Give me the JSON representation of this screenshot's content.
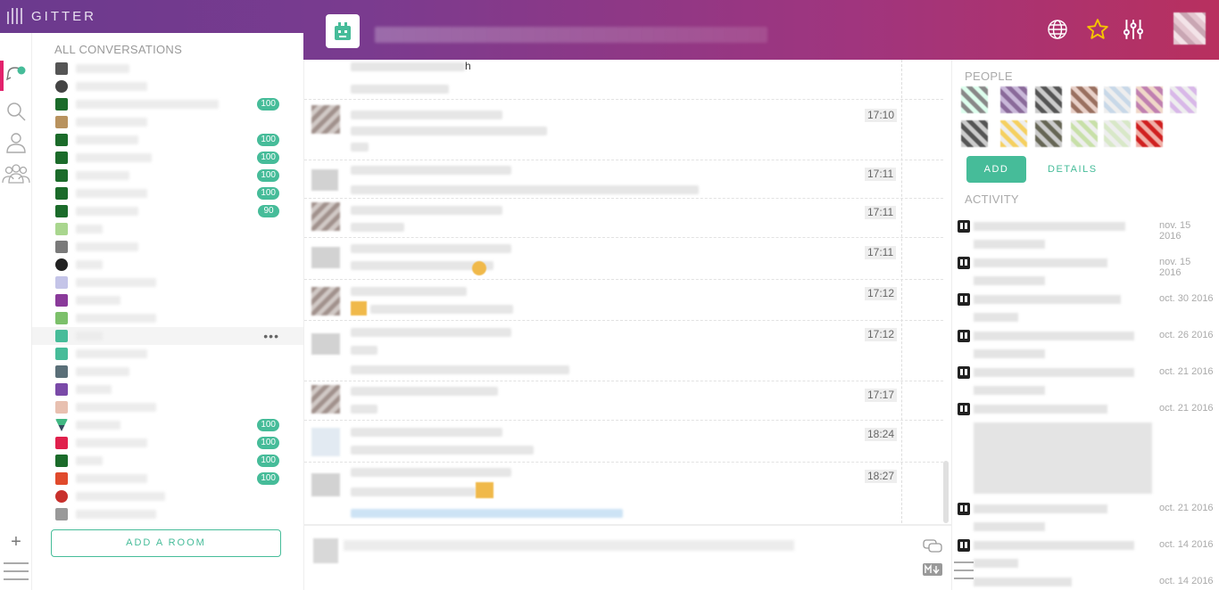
{
  "app": {
    "brand": "GITTER"
  },
  "sidebar": {
    "heading": "ALL CONVERSATIONS",
    "badges": [
      "100",
      "100",
      "100",
      "100",
      "100",
      "90",
      "100",
      "100",
      "100",
      "100"
    ],
    "add_room_label": "ADD A ROOM"
  },
  "chat": {
    "timestamps": [
      "17:10",
      "17:11",
      "17:11",
      "17:11",
      "17:12",
      "17:12",
      "17:17",
      "18:24",
      "18:27"
    ],
    "fragment": "h"
  },
  "right_panel": {
    "people_heading": "PEOPLE",
    "add_label": "ADD",
    "details_label": "DETAILS",
    "activity_heading": "ACTIVITY",
    "activity_dates": [
      "nov. 15 2016",
      "nov. 15 2016",
      "oct. 30 2016",
      "oct. 26 2016",
      "oct. 21 2016",
      "oct. 21 2016",
      "oct. 21 2016",
      "oct. 14 2016",
      "oct. 14 2016"
    ]
  },
  "colors": {
    "accent": "#46bc99",
    "active_rail": "#e2226c",
    "topbar_start": "#6b3a8e",
    "topbar_end": "#b8305f"
  }
}
